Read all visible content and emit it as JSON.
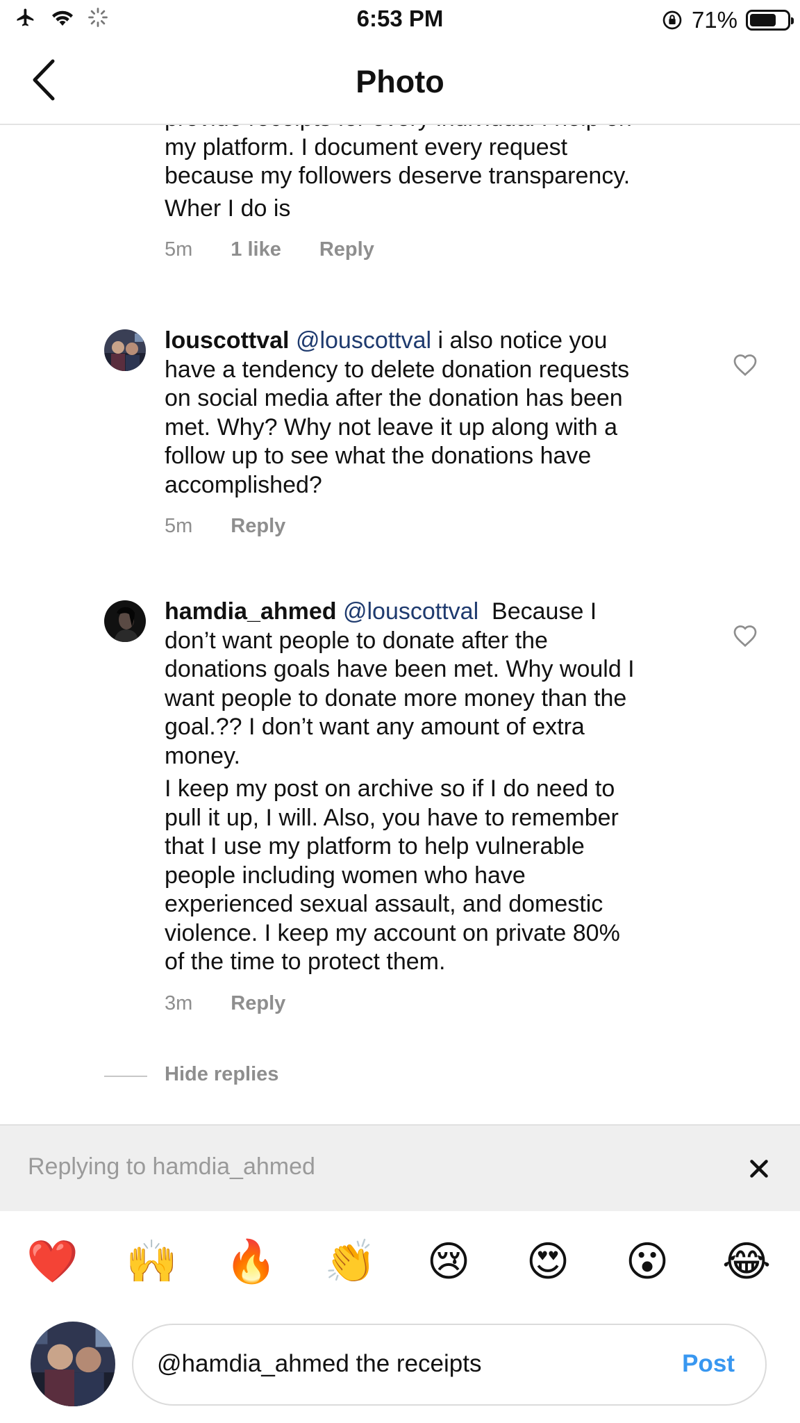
{
  "status_bar": {
    "time": "6:53 PM",
    "battery": "71%"
  },
  "nav": {
    "title": "Photo"
  },
  "comments": [
    {
      "text_lines": [
        "provide receipts for every individual I help on",
        "my platform. I document every request",
        "because my followers deserve transparency.",
        "Wher I do is"
      ],
      "time": "5m",
      "likes": "1 like",
      "reply": "Reply"
    },
    {
      "username": "louscottval",
      "mention": "@louscottval",
      "text_first": "i also notice you",
      "text_lines": [
        "have a tendency to delete donation requests",
        "on social media after the donation has been",
        "met. Why? Why not leave it up along with a",
        "follow up to see what the donations have",
        "accomplished?"
      ],
      "time": "5m",
      "reply": "Reply"
    },
    {
      "username": "hamdia_ahmed",
      "mention": "@louscottval",
      "text_first": "Because I",
      "text_lines": [
        "don’t want people to donate after the",
        "donations goals have been met. Why would I",
        "want people to donate more money than the",
        "goal.?? I don’t want any amount of extra",
        "money."
      ],
      "text_lines_2": [
        "I keep my post on archive so if I do need to",
        "pull it up, I will.  Also, you have to remember",
        "that I use my platform to help vulnerable",
        "people including women who have",
        "experienced sexual assault, and domestic",
        "violence. I keep my account on private 80%",
        "of the time to protect them."
      ],
      "time": "3m",
      "reply": "Reply"
    }
  ],
  "hide_replies": "Hide replies",
  "replying": {
    "text": "Replying to hamdia_ahmed"
  },
  "emoji_bar": [
    "❤️",
    "🙌",
    "🔥",
    "👏",
    "😢",
    "😍",
    "😮",
    "😂"
  ],
  "composer": {
    "value": "@hamdia_ahmed the receipts",
    "post_label": "Post"
  }
}
